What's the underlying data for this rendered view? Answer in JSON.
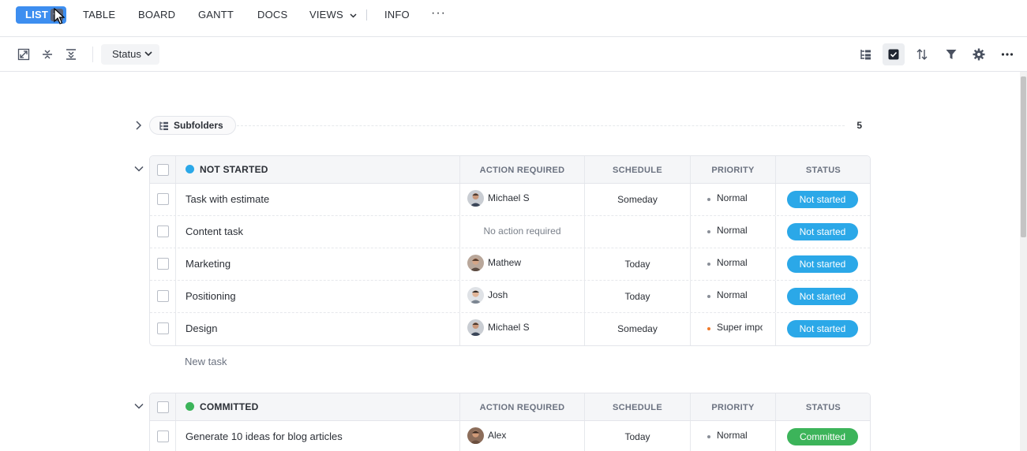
{
  "nav": {
    "list": "LIST",
    "table": "TABLE",
    "board": "BOARD",
    "gantt": "GANTT",
    "docs": "DOCS",
    "views": "VIEWS",
    "info": "INFO",
    "more": "···"
  },
  "toolbar": {
    "status_filter": "Status",
    "icons": [
      "expand-icon",
      "collapse-icon",
      "collapse-all-icon",
      "hierarchy-icon",
      "checkbox-view-icon",
      "sort-icon",
      "filter-icon",
      "settings-icon",
      "more-icon"
    ]
  },
  "subfolders": {
    "label": "Subfolders",
    "count": "5"
  },
  "columns": {
    "action": "ACTION REQUIRED",
    "schedule": "SCHEDULE",
    "priority": "PRIORITY",
    "status": "STATUS"
  },
  "groups": [
    {
      "title": "NOT STARTED",
      "color": "#2ba8e8",
      "tasks": [
        {
          "name": "Task with estimate",
          "assignee": "Michael S",
          "schedule": "Someday",
          "priority": "Normal",
          "status": "Not started"
        },
        {
          "name": "Content task",
          "action": "No action required",
          "schedule": "",
          "priority": "Normal",
          "status": "Not started"
        },
        {
          "name": "Marketing",
          "assignee": "Mathew",
          "schedule": "Today",
          "priority": "Normal",
          "status": "Not started"
        },
        {
          "name": "Positioning",
          "assignee": "Josh",
          "schedule": "Today",
          "priority": "Normal",
          "status": "Not started"
        },
        {
          "name": "Design",
          "assignee": "Michael S",
          "schedule": "Someday",
          "priority": "Super important",
          "status": "Not started"
        }
      ]
    },
    {
      "title": "COMMITTED",
      "color": "#3cb45a",
      "tasks": [
        {
          "name": "Generate 10 ideas for blog articles",
          "assignee": "Alex",
          "schedule": "Today",
          "priority": "Normal",
          "status": "Committed"
        }
      ]
    }
  ],
  "new_task": "New task",
  "colors": {
    "accent": "#3d8ef0",
    "not_started": "#2ba8e8",
    "committed": "#3cb45a",
    "priority_normal": "#8a8f98",
    "priority_super": "#f07a2a"
  }
}
